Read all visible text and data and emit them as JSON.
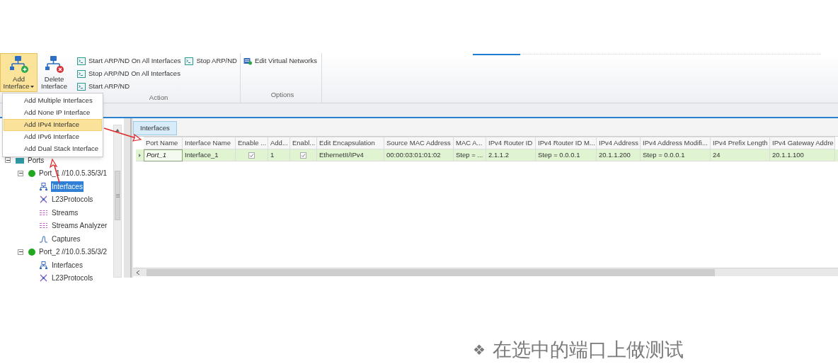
{
  "ribbon": {
    "large_buttons": [
      {
        "kind": "add",
        "label": "Add Interface",
        "dropdown": true,
        "selected": true
      },
      {
        "kind": "delete",
        "label": "Delete Interface",
        "dropdown": false,
        "selected": false
      }
    ],
    "groups": [
      {
        "label": "Action",
        "commands": [
          "Start ARP/ND On All Interfaces",
          "Stop ARP/ND On All Interfaces",
          "Start ARP/ND",
          "Stop ARP/ND"
        ]
      },
      {
        "label": "Options",
        "commands": [
          "Edit Virtual Networks"
        ]
      }
    ]
  },
  "menu": {
    "items": [
      {
        "label": "Add Multiple Interfaces",
        "selected": false
      },
      {
        "label": "Add None IP Interface",
        "selected": false
      },
      {
        "label": "Add IPv4 Interface",
        "selected": true
      },
      {
        "label": "Add IPv6 Interface",
        "selected": false
      },
      {
        "label": "Add Dual Stack Interface",
        "selected": false
      }
    ]
  },
  "tree": [
    {
      "kind": "folder",
      "label": "Ports",
      "expanded": true,
      "selected": false,
      "children": [
        {
          "kind": "port",
          "label": "Port_1 //10.0.5.35/3/1",
          "expanded": true,
          "selected": false,
          "color": "#22a81e",
          "children": [
            {
              "kind": "interfaces",
              "label": "Interfaces",
              "selected": true
            },
            {
              "kind": "protocols",
              "label": "L23Protocols",
              "selected": false
            },
            {
              "kind": "streams",
              "label": "Streams",
              "selected": false
            },
            {
              "kind": "streams",
              "label": "Streams Analyzer",
              "selected": false
            },
            {
              "kind": "captures",
              "label": "Captures",
              "selected": false
            }
          ]
        },
        {
          "kind": "port",
          "label": "Port_2 //10.0.5.35/3/2",
          "expanded": true,
          "selected": false,
          "color": "#22a81e",
          "children": [
            {
              "kind": "interfaces",
              "label": "Interfaces",
              "selected": false
            },
            {
              "kind": "protocols",
              "label": "L23Protocols",
              "selected": false
            }
          ]
        }
      ]
    }
  ],
  "tabs": [
    {
      "label": "Interfaces",
      "selected": true
    }
  ],
  "table": {
    "columns": [
      "Port Name",
      "Interface Name",
      "Enable ...",
      "Add...",
      "Enabl...",
      "Edit Encapsulation",
      "Source MAC Address",
      "MAC A...",
      "IPv4 Router ID",
      "IPv4 Router ID M...",
      "IPv4 Address",
      "IPv4 Address Modifi...",
      "IPv4 Prefix Length",
      "IPv4 Gateway Addre"
    ],
    "rows": [
      {
        "selected": true,
        "cells": [
          {
            "kind": "edit",
            "text": "Port_1"
          },
          {
            "kind": "text",
            "text": "Interface_1"
          },
          {
            "kind": "checkbox",
            "checked": true
          },
          {
            "kind": "text",
            "text": "1"
          },
          {
            "kind": "checkbox",
            "checked": true
          },
          {
            "kind": "text",
            "text": "EthernetII/IPv4"
          },
          {
            "kind": "text",
            "text": "00:00:03:01:01:02"
          },
          {
            "kind": "text",
            "text": "Step = ..."
          },
          {
            "kind": "text",
            "text": "2.1.1.2"
          },
          {
            "kind": "text",
            "text": "Step = 0.0.0.1"
          },
          {
            "kind": "text",
            "text": "20.1.1.200"
          },
          {
            "kind": "text",
            "text": "Step = 0.0.0.1"
          },
          {
            "kind": "text",
            "text": "24"
          },
          {
            "kind": "text",
            "text": "20.1.1.100"
          }
        ]
      }
    ]
  },
  "slide": {
    "bullet": "❖",
    "caption": "在选中的端口上做测试"
  }
}
